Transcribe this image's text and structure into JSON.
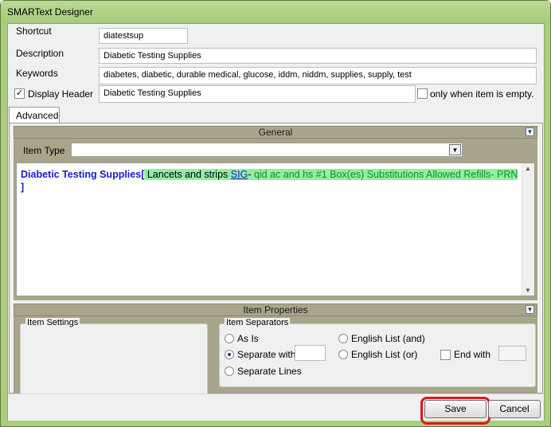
{
  "window": {
    "title": "SMARText Designer"
  },
  "fields": {
    "shortcut_label": "Shortcut",
    "shortcut_value": "diatestsup",
    "description_label": "Description",
    "description_value": "Diabetic Testing Supplies",
    "keywords_label": "Keywords",
    "keywords_value": "diabetes, diabetic, durable medical, glucose, iddm, niddm, supplies, supply, test",
    "display_header_label": "Display Header",
    "display_header_checked": true,
    "display_header_value": "Diabetic Testing Supplies",
    "only_when_empty_label": "only when item is empty.",
    "only_when_empty_checked": false
  },
  "tabs": [
    {
      "label": "Advanced",
      "selected": true
    }
  ],
  "general": {
    "title": "General",
    "item_type_label": "Item Type",
    "item_type_value": "",
    "editor": {
      "header": "Diabetic Testing Supplies",
      "open_bracket": "[",
      "segment1": " Lancets and strips ",
      "sig_label": "SIG",
      "sig_dash": "- ",
      "segment2": " qid ac and hs #1 Box(es)  Substitutions Allowed ",
      "refills_label": "Refills",
      "refills_dash": "- ",
      "refills_value": "PRN ",
      "close_bracket": "]"
    }
  },
  "item_properties": {
    "title": "Item Properties",
    "item_settings_label": "Item Settings",
    "item_separators_label": "Item Separators",
    "options": [
      {
        "label": "As Is",
        "selected": false
      },
      {
        "label": "Separate with",
        "selected": true
      },
      {
        "label": "Separate Lines",
        "selected": false
      },
      {
        "label": "English List (and)",
        "selected": false
      },
      {
        "label": "English List (or)",
        "selected": false
      }
    ],
    "end_with_label": "End with",
    "end_with_checked": false
  },
  "buttons": {
    "save": "Save",
    "cancel": "Cancel"
  },
  "colors": {
    "highlight_box": "#e0161e",
    "window_chrome": "#a9ce7e",
    "section_bar": "#a8a58a"
  }
}
